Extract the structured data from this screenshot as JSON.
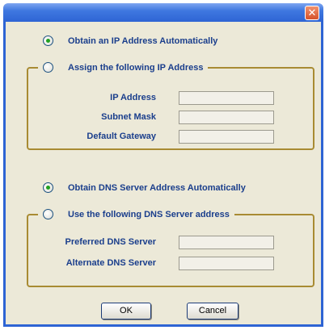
{
  "window": {
    "close_glyph": "✕"
  },
  "ip": {
    "auto_label": "Obtain an IP Address Automatically",
    "manual_label": "Assign the following IP Address",
    "selected": "auto",
    "fields": [
      {
        "label": "IP Address",
        "value": ""
      },
      {
        "label": "Subnet Mask",
        "value": ""
      },
      {
        "label": "Default Gateway",
        "value": ""
      }
    ]
  },
  "dns": {
    "auto_label": "Obtain DNS Server Address Automatically",
    "manual_label": "Use the following DNS Server address",
    "selected": "auto",
    "fields": [
      {
        "label": "Preferred DNS Server",
        "value": ""
      },
      {
        "label": "Alternate DNS Server",
        "value": ""
      }
    ]
  },
  "buttons": {
    "ok_label": "OK",
    "cancel_label": "Cancel"
  },
  "colors": {
    "titlebar": "#2e64d4",
    "dialog_bg": "#ece9d8",
    "label_text": "#1a3e8c",
    "group_border": "#a88b33",
    "radio_selected": "#21a121"
  }
}
